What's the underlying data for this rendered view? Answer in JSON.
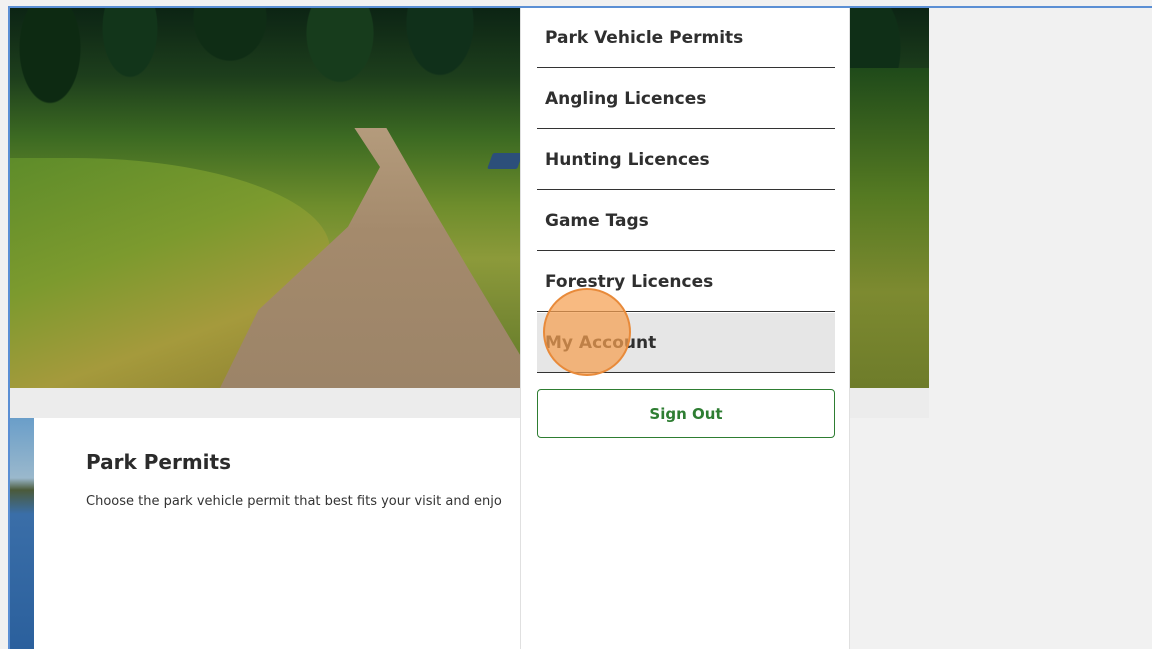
{
  "menu": {
    "items": [
      {
        "label": "Park Vehicle Permits"
      },
      {
        "label": "Angling Licences"
      },
      {
        "label": "Hunting Licences"
      },
      {
        "label": "Game Tags"
      },
      {
        "label": "Forestry Licences"
      },
      {
        "label": "My Account"
      }
    ],
    "sign_out_label": "Sign Out"
  },
  "card": {
    "title": "Park Permits",
    "text": "Choose the park vehicle permit that best fits your visit and enjo"
  },
  "colors": {
    "accent_green": "#2e7d32",
    "frame_blue": "#5b8fd4",
    "click_indicator": "#f5a050"
  }
}
